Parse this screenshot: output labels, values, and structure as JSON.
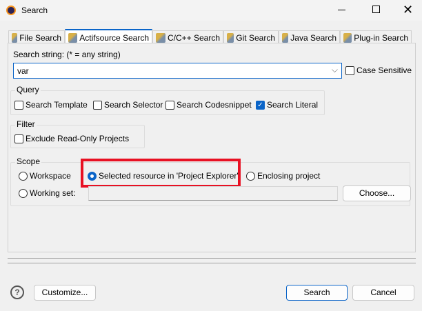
{
  "window": {
    "title": "Search"
  },
  "tabs": [
    {
      "label": "File Search"
    },
    {
      "label": "Actifsource Search",
      "active": true
    },
    {
      "label": "C/C++ Search"
    },
    {
      "label": "Git Search"
    },
    {
      "label": "Java Search"
    },
    {
      "label": "Plug-in Search"
    }
  ],
  "search": {
    "label": "Search string: (* = any string)",
    "value": "var",
    "case_sensitive": "Case Sensitive",
    "case_checked": false
  },
  "query": {
    "title": "Query",
    "items": [
      {
        "label": "Search Template",
        "checked": false
      },
      {
        "label": "Search Selector",
        "checked": false
      },
      {
        "label": "Search Codesnippet",
        "checked": false
      },
      {
        "label": "Search Literal",
        "checked": true
      }
    ]
  },
  "filter": {
    "title": "Filter",
    "items": [
      {
        "label": "Exclude Read-Only Projects",
        "checked": false
      }
    ]
  },
  "scope": {
    "title": "Scope",
    "workspace": "Workspace",
    "selected_resource": "Selected resource in 'Project Explorer'",
    "enclosing": "Enclosing project",
    "working_set": "Working set:",
    "working_set_value": "",
    "choose": "Choose...",
    "selected": "selected_resource"
  },
  "highlight_color": "#e81123",
  "buttons": {
    "customize": "Customize...",
    "search": "Search",
    "cancel": "Cancel"
  }
}
